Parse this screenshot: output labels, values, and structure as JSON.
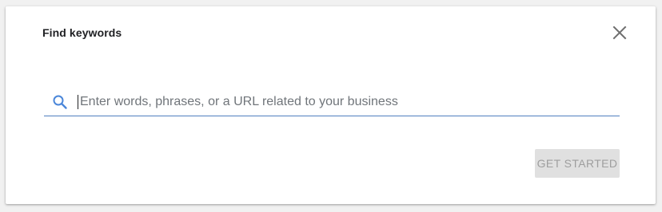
{
  "dialog": {
    "title": "Find keywords",
    "close_icon": "close-icon",
    "search": {
      "icon": "search-icon",
      "value": "",
      "placeholder": "Enter words, phrases, or a URL related to your business"
    },
    "primary_button": {
      "label": "GET STARTED",
      "disabled": true
    }
  },
  "colors": {
    "accent": "#4f7fbf",
    "search_icon": "#4a86d9",
    "button_bg_disabled": "#e0e0e0",
    "button_text_disabled": "#9e9e9e"
  }
}
